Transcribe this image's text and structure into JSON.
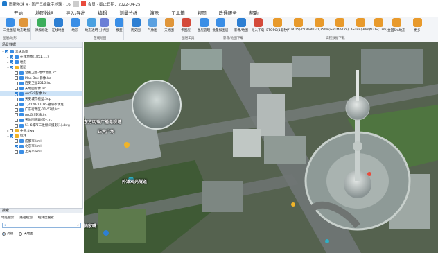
{
  "titlebar": {
    "title": "图新地球 4 · 国产三维数字地球 · 16",
    "account": "会员 · 截止日期：2022-04-25"
  },
  "menu": [
    "开始",
    "地图数据",
    "导入/导出",
    "编辑",
    "测量分析",
    "演示",
    "工具箱",
    "视图",
    "政通服务",
    "帮助"
  ],
  "ribbon": {
    "buttons": [
      {
        "label": "三维图层",
        "color": "#3a8ee6"
      },
      {
        "label": "地形数据",
        "color": "#e0963a"
      },
      {
        "label": "添加标注",
        "color": "#3cae5c"
      },
      {
        "label": "在线地图",
        "color": "#2d7fd3"
      },
      {
        "label": "地形",
        "color": "#3a8ee6"
      },
      {
        "label": "地形透明",
        "color": "#4aa0e0"
      },
      {
        "label": "分析图",
        "color": "#6a7fd6"
      },
      {
        "label": "模型",
        "color": "#3a8ee6"
      },
      {
        "label": "历史图",
        "color": "#2d7fd3"
      },
      {
        "label": "气象图",
        "color": "#5aa0e0"
      },
      {
        "label": "天地图",
        "color": "#e0963a"
      },
      {
        "label": "卡图层",
        "color": "#d44a3a"
      },
      {
        "label": "图层管理",
        "color": "#3a8ee6"
      },
      {
        "label": "批量加图层",
        "color": "#3a8ee6"
      },
      {
        "label": "影像/地图",
        "color": "#2d7fd3"
      },
      {
        "label": "导入下载",
        "color": "#d44a3a"
      },
      {
        "label": "ETOPO(1弧秒)",
        "color": "#e89a2c"
      },
      {
        "label": "SRTM 15(450m)",
        "color": "#e89a2c"
      },
      {
        "label": "GMTED(250m)",
        "color": "#e89a2c"
      },
      {
        "label": "SRTM(90m)",
        "color": "#e89a2c"
      },
      {
        "label": "ASTER(30m)",
        "color": "#e89a2c"
      },
      {
        "label": "ALOS(12m)",
        "color": "#e89a2c"
      },
      {
        "label": "全国5m地形",
        "color": "#e89a2c"
      },
      {
        "label": "更多",
        "color": "#e89a2c"
      }
    ],
    "groups": [
      "图层/地形",
      "在线地图",
      "图层工具",
      "影像/地图下载",
      "高程数据下载"
    ]
  },
  "left_panel": {
    "header": "场景数据",
    "tree": [
      {
        "label": "三维场景",
        "level": 0,
        "checked": true,
        "expand": "▾",
        "icon": "#3a8ee6"
      },
      {
        "label": "在线地图(1851.....)",
        "level": 1,
        "checked": true,
        "expand": "▸",
        "icon": "#3a8ee6"
      },
      {
        "label": "地形",
        "level": 1,
        "checked": true,
        "expand": "▸",
        "icon": "#3a8ee6"
      },
      {
        "label": "图层",
        "level": 1,
        "checked": true,
        "expand": "▾",
        "icon": "#f0b429"
      },
      {
        "label": "合肥卫星-地球地板.lrc",
        "level": 2,
        "checked": false,
        "expand": "",
        "icon": "#3a8ee6"
      },
      {
        "label": "Map Box 影像.lrc",
        "level": 2,
        "checked": false,
        "expand": "",
        "icon": "#3a8ee6"
      },
      {
        "label": "西安卫星2016.lrc",
        "level": 2,
        "checked": false,
        "expand": "",
        "icon": "#3a8ee6"
      },
      {
        "label": "天地图影像.lrc",
        "level": 2,
        "checked": false,
        "expand": "",
        "icon": "#3a8ee6"
      },
      {
        "label": "ArcGIS影像.lrc",
        "level": 2,
        "checked": true,
        "expand": "",
        "icon": "#3a8ee6",
        "selected": true
      },
      {
        "label": "天安城市模型.3dp",
        "level": 2,
        "checked": false,
        "expand": "",
        "icon": "#3a8ee6"
      },
      {
        "label": "1,2020-12-16-德阳市精准...",
        "level": 2,
        "checked": false,
        "expand": "",
        "icon": "#3a8ee6"
      },
      {
        "label": "广东行政区-11-57级.lrc",
        "level": 2,
        "checked": false,
        "expand": "",
        "icon": "#3a8ee6"
      },
      {
        "label": "ArcGIS影像.lrc",
        "level": 2,
        "checked": false,
        "expand": "",
        "icon": "#3a8ee6"
      },
      {
        "label": "天地图道路标注.lrc",
        "level": 2,
        "checked": false,
        "expand": "",
        "icon": "#3a8ee6"
      },
      {
        "label": "51-6城市三维倾斜摄影(1).dwg",
        "level": 2,
        "checked": false,
        "expand": "",
        "icon": "#3a8ee6"
      },
      {
        "label": "中国.dwg",
        "level": 1,
        "checked": false,
        "expand": "▸",
        "icon": "#f0b429"
      },
      {
        "label": "标注",
        "level": 1,
        "checked": true,
        "expand": "▾",
        "icon": "#f0b429"
      },
      {
        "label": "成都市.kml",
        "level": 2,
        "checked": false,
        "expand": "",
        "icon": "#3a8ee6"
      },
      {
        "label": "北京市.kml",
        "level": 2,
        "checked": true,
        "expand": "",
        "icon": "#3a8ee6"
      },
      {
        "label": "上海市.kml",
        "level": 2,
        "checked": false,
        "expand": "",
        "icon": "#3a8ee6"
      }
    ]
  },
  "search_panel": {
    "header": "搜索",
    "tabs": [
      "地名搜索",
      "路径规划",
      "经纬度搜索"
    ],
    "input_placeholder": "",
    "radios": [
      {
        "label": "高德",
        "on": true
      },
      {
        "label": "天地图",
        "on": false
      }
    ]
  },
  "map": {
    "labels": [
      "东方明珠广播电视塔",
      "正大广场",
      "外滩观光隧道",
      "陆家嘴"
    ]
  }
}
